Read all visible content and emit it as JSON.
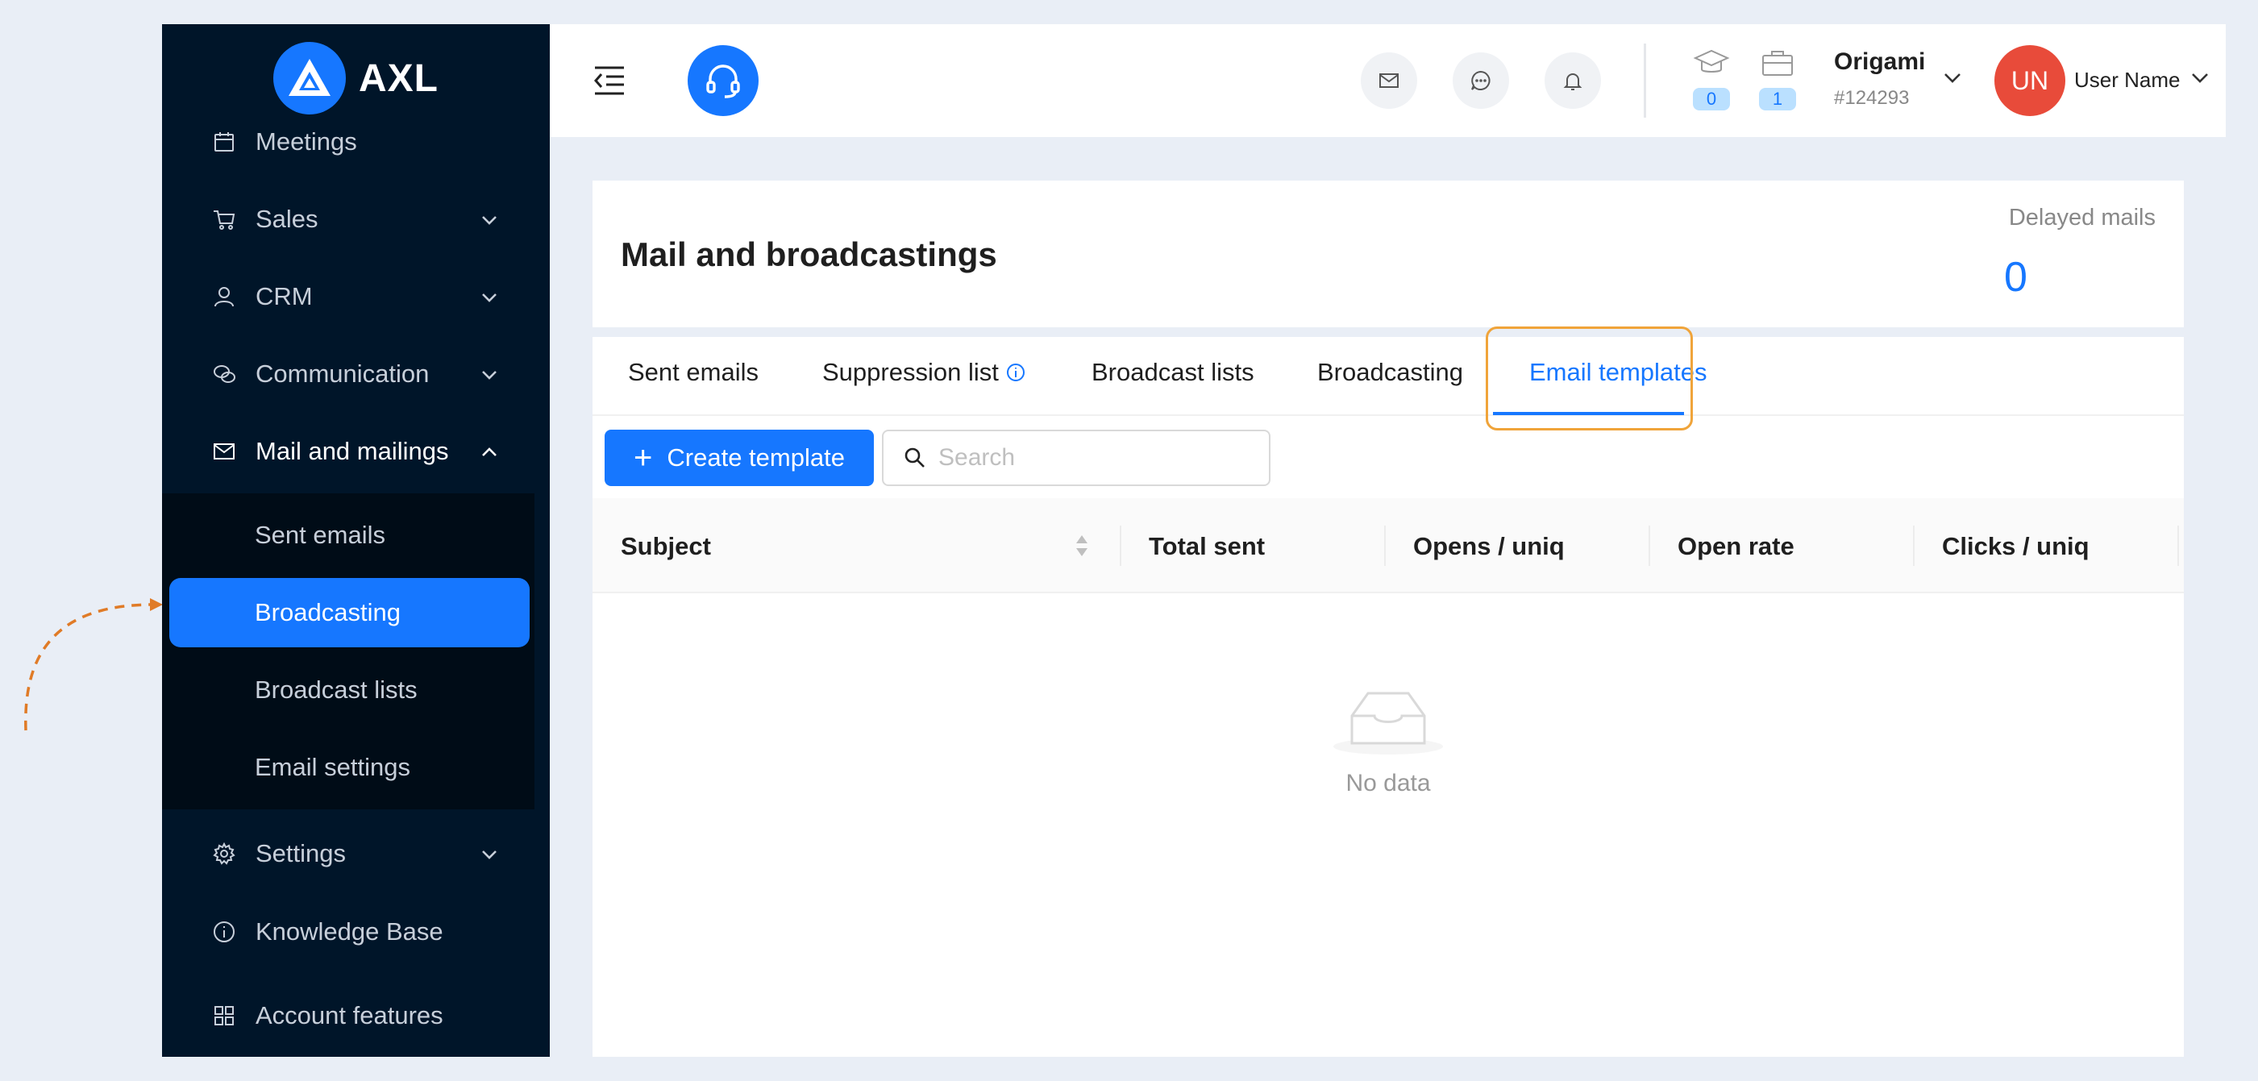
{
  "brand": {
    "name": "AXL"
  },
  "sidebar": {
    "items": [
      {
        "label": "Meetings",
        "icon": "calendar-icon"
      },
      {
        "label": "Sales",
        "icon": "cart-icon"
      },
      {
        "label": "CRM",
        "icon": "user-icon"
      },
      {
        "label": "Communication",
        "icon": "wechat-icon"
      },
      {
        "label": "Mail and mailings",
        "icon": "mail-icon"
      },
      {
        "label": "Settings",
        "icon": "gear-icon"
      },
      {
        "label": "Knowledge Base",
        "icon": "info-icon"
      },
      {
        "label": "Account features",
        "icon": "grid-icon"
      }
    ],
    "submenu": [
      {
        "label": "Sent emails"
      },
      {
        "label": "Broadcasting"
      },
      {
        "label": "Broadcast lists"
      },
      {
        "label": "Email settings"
      }
    ]
  },
  "header": {
    "graduation_count": "0",
    "briefcase_count": "1",
    "company_name": "Origami",
    "company_id": "#124293",
    "avatar_initials": "UN",
    "user_name": "User Name"
  },
  "page": {
    "title": "Mail and broadcastings",
    "delayed_label": "Delayed mails",
    "delayed_value": "0"
  },
  "tabs": [
    {
      "label": "Sent emails"
    },
    {
      "label": "Suppression list"
    },
    {
      "label": "Broadcast lists"
    },
    {
      "label": "Broadcasting"
    },
    {
      "label": "Email templates"
    }
  ],
  "toolbar": {
    "create_label": "Create template",
    "search_placeholder": "Search"
  },
  "table": {
    "columns": [
      "Subject",
      "Total sent",
      "Opens / uniq",
      "Open rate",
      "Clicks / uniq"
    ],
    "empty_text": "No data"
  },
  "colors": {
    "accent": "#1677ff",
    "sidebar_bg": "#001529",
    "highlight": "#f0a43a",
    "avatar_bg": "#e84b3a"
  }
}
